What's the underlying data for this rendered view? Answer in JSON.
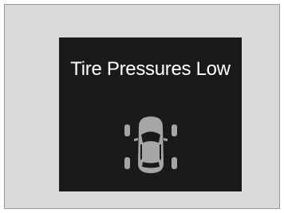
{
  "warning": {
    "message": "Tire Pressures Low",
    "icon": "car-top-view-tires-icon",
    "background_color": "#1a1a1a",
    "text_color": "#ffffff",
    "icon_color": "#a6a6a6"
  }
}
